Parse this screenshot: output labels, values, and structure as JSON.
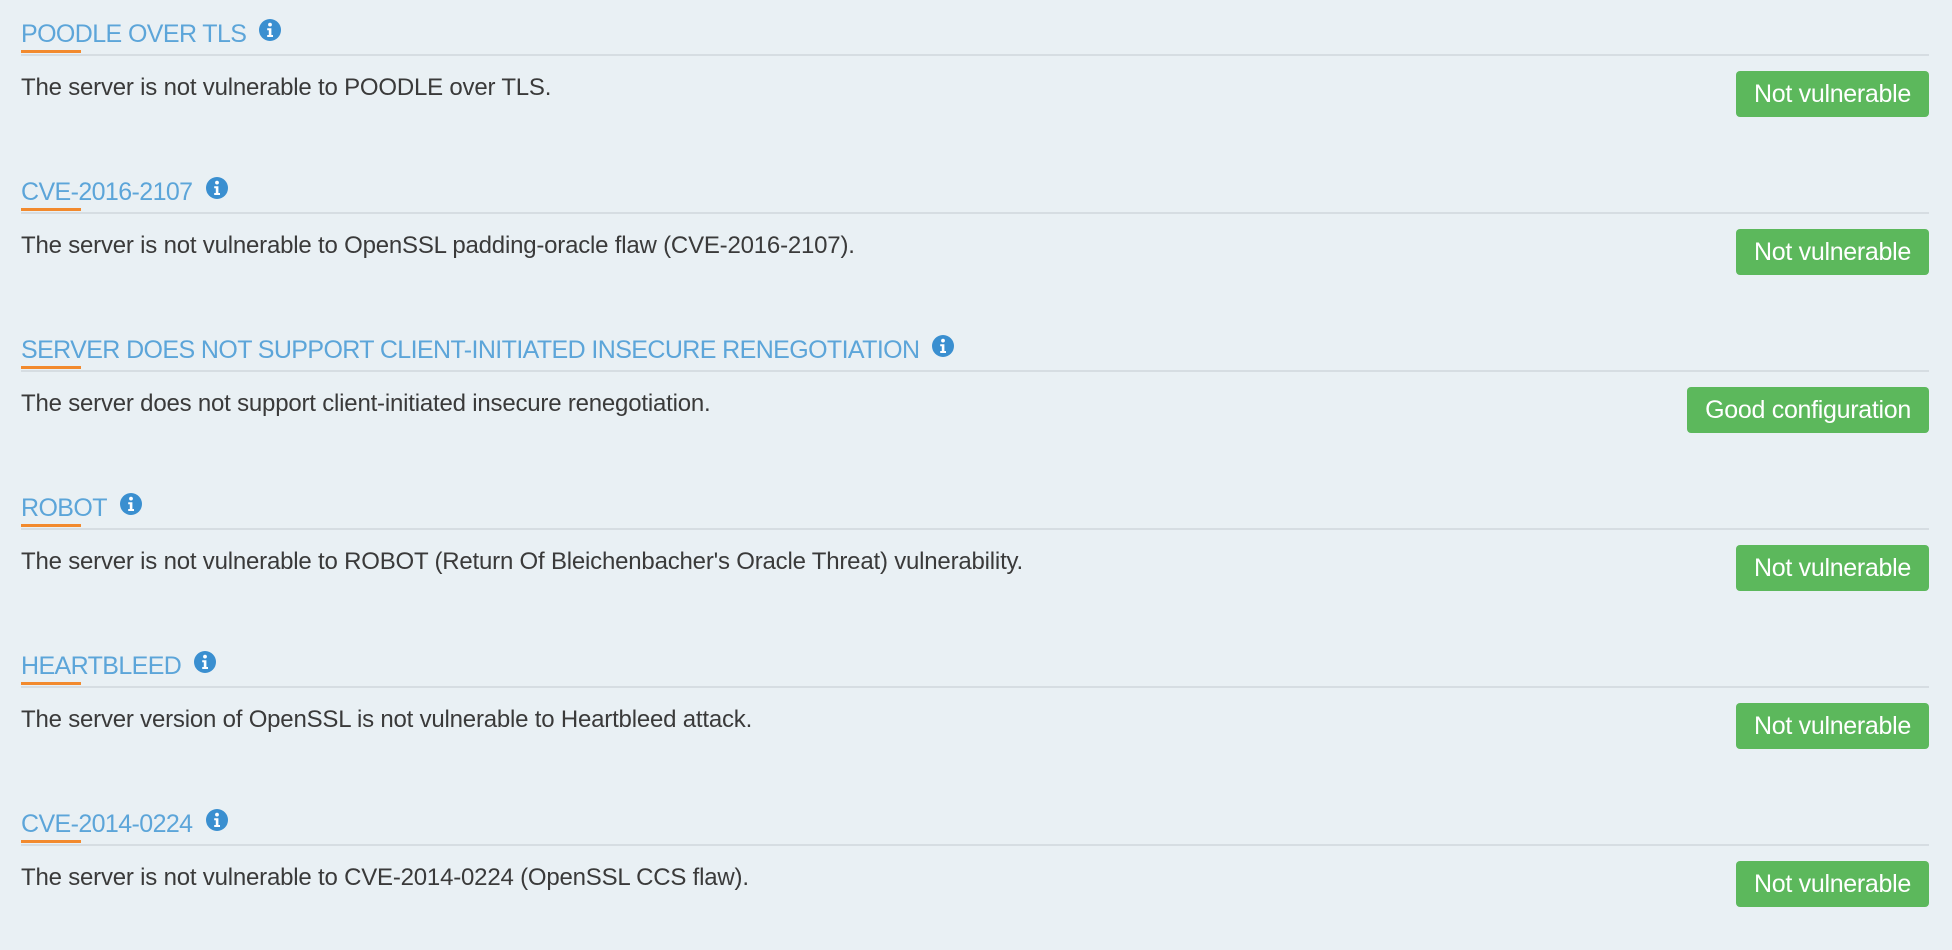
{
  "colors": {
    "background": "#e9f0f4",
    "title": "#5ca5d9",
    "accent_underline": "#f28a2e",
    "status_good": "#5cb85c",
    "info_icon": "#3a8fd0"
  },
  "checks": [
    {
      "title": "POODLE OVER TLS",
      "icon": "info-icon",
      "description": "The server is not vulnerable to POODLE over TLS.",
      "status": "Not vulnerable"
    },
    {
      "title": "CVE-2016-2107",
      "icon": "info-icon",
      "description": "The server is not vulnerable to OpenSSL padding-oracle flaw (CVE-2016-2107).",
      "status": "Not vulnerable"
    },
    {
      "title": "SERVER DOES NOT SUPPORT CLIENT-INITIATED INSECURE RENEGOTIATION",
      "icon": "info-icon",
      "description": "The server does not support client-initiated insecure renegotiation.",
      "status": "Good configuration"
    },
    {
      "title": "ROBOT",
      "icon": "info-icon",
      "description": "The server is not vulnerable to ROBOT (Return Of Bleichenbacher's Oracle Threat) vulnerability.",
      "status": "Not vulnerable"
    },
    {
      "title": "HEARTBLEED",
      "icon": "info-icon",
      "description": "The server version of OpenSSL is not vulnerable to Heartbleed attack.",
      "status": "Not vulnerable"
    },
    {
      "title": "CVE-2014-0224",
      "icon": "info-icon",
      "description": "The server is not vulnerable to CVE-2014-0224 (OpenSSL CCS flaw).",
      "status": "Not vulnerable"
    }
  ]
}
